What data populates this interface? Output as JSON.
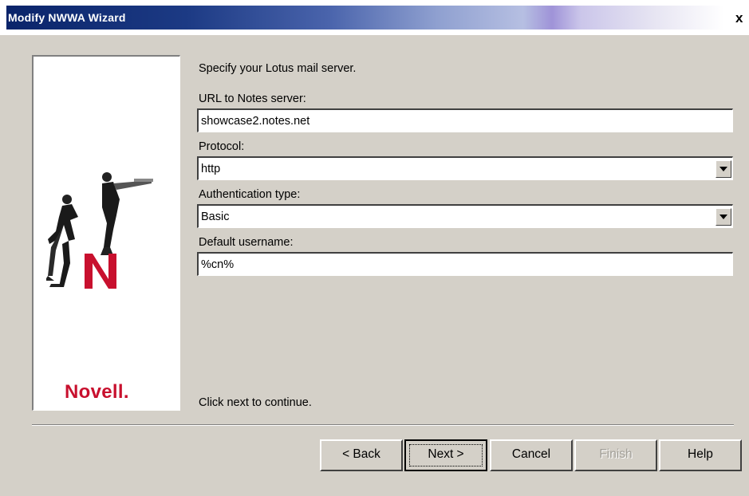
{
  "window": {
    "title": "Modify NWWA Wizard",
    "close_glyph": "x"
  },
  "brand": {
    "logo_text": "Novell."
  },
  "form": {
    "intro": "Specify your Lotus mail server.",
    "url_label": "URL to Notes server:",
    "url_value": "showcase2.notes.net",
    "protocol_label": "Protocol:",
    "protocol_value": "http",
    "auth_label": "Authentication type:",
    "auth_value": "Basic",
    "username_label": "Default username:",
    "username_value": "%cn%",
    "footer_hint": "Click next to continue."
  },
  "buttons": {
    "back": "< Back",
    "next": "Next >",
    "cancel": "Cancel",
    "finish": "Finish",
    "help": "Help"
  },
  "colors": {
    "title_bar": "#0a246a",
    "face": "#d4d0c8",
    "brand_red": "#c8102e"
  },
  "icons": [
    "close-icon",
    "dropdown-arrow-icon",
    "novell-wizard-illustration"
  ]
}
